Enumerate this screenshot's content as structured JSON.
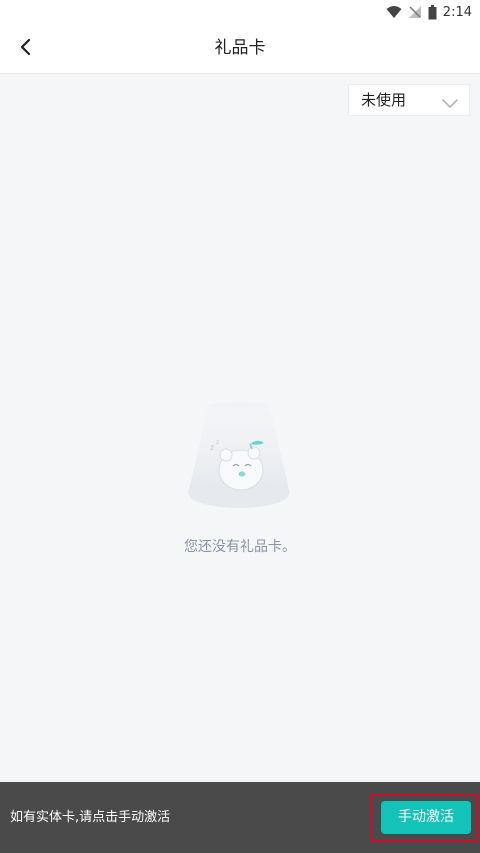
{
  "status_bar": {
    "time": "2:14"
  },
  "header": {
    "title": "礼品卡"
  },
  "filter": {
    "selected": "未使用"
  },
  "empty_state": {
    "message": "您还没有礼品卡。"
  },
  "bottom_bar": {
    "hint": "如有实体卡,请点击手动激活",
    "activate_label": "手动激活"
  },
  "colors": {
    "accent": "#14c3b7",
    "bottom_bar_bg": "#4a4a4a",
    "highlight_border": "#c8102e",
    "page_bg": "#f5f6f8"
  },
  "icons": {
    "back": "chevron-left-icon",
    "dropdown": "chevron-down-icon",
    "wifi": "wifi-icon",
    "signal": "no-signal-icon",
    "battery": "battery-icon"
  }
}
